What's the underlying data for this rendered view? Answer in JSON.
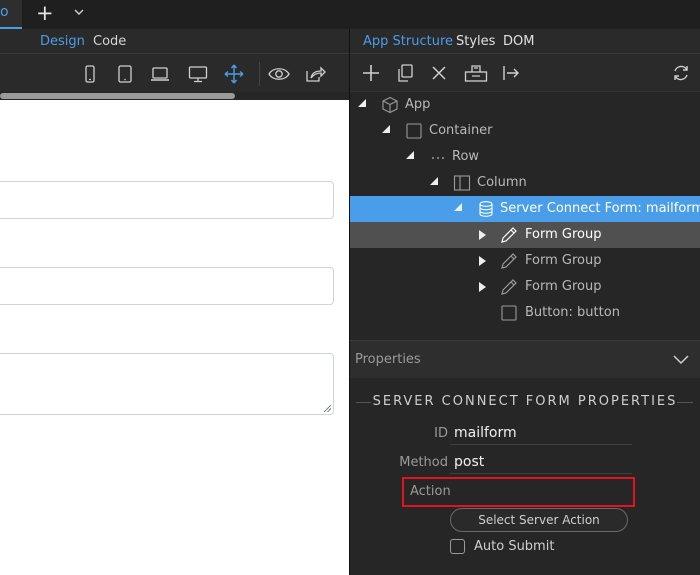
{
  "tabstrip": {
    "add_symbol": "+",
    "menu_symbol": "⌄",
    "active_tab_fragment": "o"
  },
  "view_header": {
    "tabs": [
      {
        "label": "Design",
        "active": true
      },
      {
        "label": "Code",
        "active": false
      }
    ]
  },
  "left_toolbar": {
    "icons": [
      "phone-icon",
      "tablet-icon",
      "laptop-icon",
      "desktop-icon",
      "move-icon",
      "eye-icon",
      "share-icon"
    ]
  },
  "panel": {
    "tabs": [
      {
        "label": "App Structure",
        "active": true
      },
      {
        "label": "Styles"
      },
      {
        "label": "DOM"
      }
    ],
    "toolbar_icons": [
      "add-icon",
      "duplicate-icon",
      "delete-icon",
      "wrap-icon",
      "move-out-icon",
      "refresh-icon"
    ],
    "tree": [
      {
        "label": "App",
        "icon": "cube-icon",
        "level": 0,
        "state": "expanded"
      },
      {
        "label": "Container",
        "icon": "square-icon",
        "level": 1,
        "state": "expanded"
      },
      {
        "label": "Row",
        "icon": "dots-icon",
        "level": 2,
        "state": "expanded"
      },
      {
        "label": "Column",
        "icon": "columns-icon",
        "level": 3,
        "state": "expanded"
      },
      {
        "label": "Server Connect Form: mailform",
        "icon": "database-icon",
        "level": 4,
        "state": "expanded",
        "selected": true
      },
      {
        "label": "Form Group",
        "icon": "pencil-icon",
        "level": 5,
        "state": "collapsed",
        "hover": true
      },
      {
        "label": "Form Group",
        "icon": "pencil-icon",
        "level": 5,
        "state": "collapsed"
      },
      {
        "label": "Form Group",
        "icon": "pencil-icon",
        "level": 5,
        "state": "collapsed"
      },
      {
        "label": "Button: button",
        "icon": "square-icon",
        "level": 5,
        "state": "leaf"
      }
    ]
  },
  "properties": {
    "header": "Properties",
    "section_title": "SERVER CONNECT FORM PROPERTIES",
    "id": {
      "label": "ID",
      "value": "mailform"
    },
    "method": {
      "label": "Method",
      "value": "post"
    },
    "action": {
      "label": "Action",
      "value": ""
    },
    "select_button": "Select Server Action",
    "auto_submit": {
      "label": "Auto Submit",
      "checked": false
    }
  },
  "colors": {
    "accent": "#4a9de8",
    "highlight": "#e3141e",
    "panel": "#262626",
    "canvas": "#ffffff"
  }
}
